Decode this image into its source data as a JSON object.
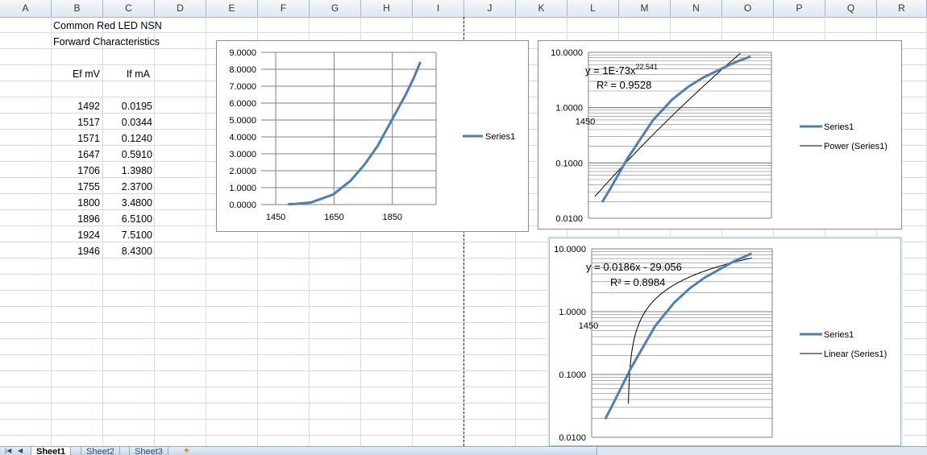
{
  "columns": [
    "A",
    "B",
    "C",
    "D",
    "E",
    "F",
    "G",
    "H",
    "I",
    "J",
    "K",
    "L",
    "M",
    "N",
    "O",
    "P",
    "Q",
    "R"
  ],
  "sheet": {
    "title_line1": "Common Red LED NSN",
    "title_line2": "Forward Characteristics",
    "header_ef": "Ef mV",
    "header_if": "If mA",
    "rows": [
      {
        "ef": "1492",
        "if": "0.0195"
      },
      {
        "ef": "1517",
        "if": "0.0344"
      },
      {
        "ef": "1571",
        "if": "0.1240"
      },
      {
        "ef": "1647",
        "if": "0.5910"
      },
      {
        "ef": "1706",
        "if": "1.3980"
      },
      {
        "ef": "1755",
        "if": "2.3700"
      },
      {
        "ef": "1800",
        "if": "3.4800"
      },
      {
        "ef": "1896",
        "if": "6.5100"
      },
      {
        "ef": "1924",
        "if": "7.5100"
      },
      {
        "ef": "1946",
        "if": "8.4300"
      }
    ]
  },
  "chart_data": [
    {
      "type": "line",
      "x": [
        1492,
        1517,
        1571,
        1647,
        1706,
        1755,
        1800,
        1896,
        1924,
        1946
      ],
      "series": [
        {
          "name": "Series1",
          "values": [
            0.0195,
            0.0344,
            0.124,
            0.591,
            1.398,
            2.37,
            3.48,
            6.51,
            7.51,
            8.43
          ],
          "color": "#4f7fb0"
        }
      ],
      "y_ticks": [
        "0.0000",
        "1.0000",
        "2.0000",
        "3.0000",
        "4.0000",
        "5.0000",
        "6.0000",
        "7.0000",
        "8.0000",
        "9.0000"
      ],
      "x_ticks": [
        "1450",
        "1650",
        "1850"
      ],
      "xlim": [
        1400,
        2000
      ],
      "ylim": [
        0,
        9
      ],
      "grid": true,
      "legend": "right"
    },
    {
      "type": "line",
      "yscale": "log",
      "x": [
        1492,
        1517,
        1571,
        1647,
        1706,
        1755,
        1800,
        1896,
        1924,
        1946
      ],
      "series": [
        {
          "name": "Series1",
          "values": [
            0.0195,
            0.0344,
            0.124,
            0.591,
            1.398,
            2.37,
            3.48,
            6.51,
            7.51,
            8.43
          ],
          "color": "#4f7fb0"
        },
        {
          "name": "Power (Series1)",
          "color": "#000000"
        }
      ],
      "trendline": {
        "type": "power",
        "a": 1e-73,
        "b": 22.541
      },
      "equation": "y = 1E-73x",
      "equation_exp": "22.541",
      "r2": "R² = 0.9528",
      "x_tick_label": "1450",
      "y_ticks": [
        "0.0100",
        "0.1000",
        "1.0000",
        "10.0000"
      ],
      "ylim": [
        0.01,
        10
      ],
      "grid": true,
      "legend": "right"
    },
    {
      "type": "line",
      "yscale": "log",
      "x": [
        1492,
        1517,
        1571,
        1647,
        1706,
        1755,
        1800,
        1896,
        1924,
        1946
      ],
      "series": [
        {
          "name": "Series1",
          "values": [
            0.0195,
            0.0344,
            0.124,
            0.591,
            1.398,
            2.37,
            3.48,
            6.51,
            7.51,
            8.43
          ],
          "color": "#4f7fb0"
        },
        {
          "name": "Linear (Series1)",
          "color": "#000000"
        }
      ],
      "trendline": {
        "type": "linear",
        "slope": 0.0186,
        "intercept": -29.056
      },
      "equation": "y = 0.0186x - 29.056",
      "r2": "R² = 0.8984",
      "x_tick_label": "1450",
      "y_ticks": [
        "0.0100",
        "0.1000",
        "1.0000",
        "10.0000"
      ],
      "ylim": [
        0.01,
        10
      ],
      "grid": true,
      "legend": "right"
    }
  ],
  "tabs": [
    "Sheet1",
    "Sheet2",
    "Sheet3"
  ],
  "nav_icons": [
    "first-sheet-icon",
    "prev-sheet-icon",
    "next-sheet-icon",
    "last-sheet-icon"
  ],
  "colors": {
    "series": "#4f7fb0",
    "trend": "#000000",
    "grid": "#808080",
    "header_bg": "#e4ecf7"
  }
}
